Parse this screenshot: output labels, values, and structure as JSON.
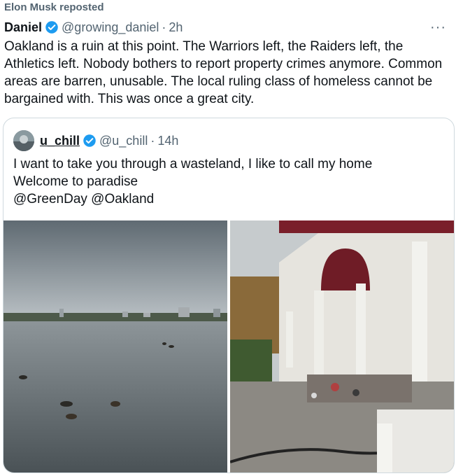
{
  "repost": {
    "label": "Elon Musk reposted"
  },
  "post": {
    "name": "Daniel",
    "handle": "@growing_daniel",
    "separator": "·",
    "time": "2h",
    "more": "···",
    "text": "Oakland is a ruin at this point. The Warriors left, the Raiders left, the Athletics left. Nobody bothers to report property crimes anymore. Common areas are barren, unusable. The local ruling class of homeless cannot be bargained with. This was once a great city."
  },
  "quote": {
    "name": "u_chill",
    "handle": "@u_chill",
    "separator": "·",
    "time": "14h",
    "lines": [
      "I want to take you through a wasteland, I like to call my home",
      "Welcome to paradise",
      "@GreenDay @Oakland"
    ]
  },
  "icons": {
    "verified": "verified-badge-icon",
    "more": "more-options-icon"
  },
  "colors": {
    "verified": "#1d9bf0",
    "muted": "#536471",
    "border": "#cfd9de"
  }
}
